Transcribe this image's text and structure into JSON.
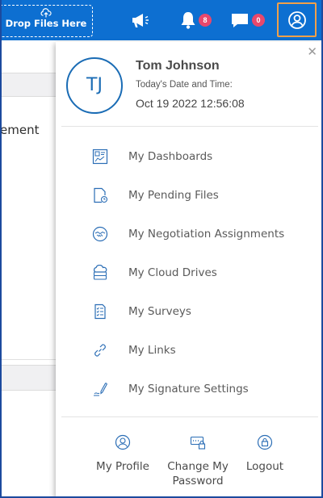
{
  "topbar": {
    "drop_files_label": "Drop Files Here",
    "notifications_count": "8",
    "messages_count": "0"
  },
  "background": {
    "partial_text": "ement"
  },
  "profile_menu": {
    "avatar_initials": "TJ",
    "user_name": "Tom Johnson",
    "date_label": "Today's Date and Time:",
    "date_value": "Oct 19 2022 12:56:08",
    "items": [
      {
        "label": "My Dashboards",
        "icon": "dashboard-icon"
      },
      {
        "label": "My Pending Files",
        "icon": "pending-files-icon"
      },
      {
        "label": "My Negotiation Assignments",
        "icon": "negotiation-icon"
      },
      {
        "label": "My Cloud Drives",
        "icon": "cloud-drive-icon"
      },
      {
        "label": "My Surveys",
        "icon": "survey-icon"
      },
      {
        "label": "My Links",
        "icon": "link-icon"
      },
      {
        "label": "My Signature Settings",
        "icon": "signature-icon"
      }
    ],
    "footer": {
      "my_profile": "My Profile",
      "change_password_line1": "Change My",
      "change_password_line2": "Password",
      "logout": "Logout"
    }
  },
  "colors": {
    "topbar": "#0d6fd1",
    "accent": "#1a6cb5",
    "badge": "#e8486c",
    "highlight": "#f0a04a"
  }
}
